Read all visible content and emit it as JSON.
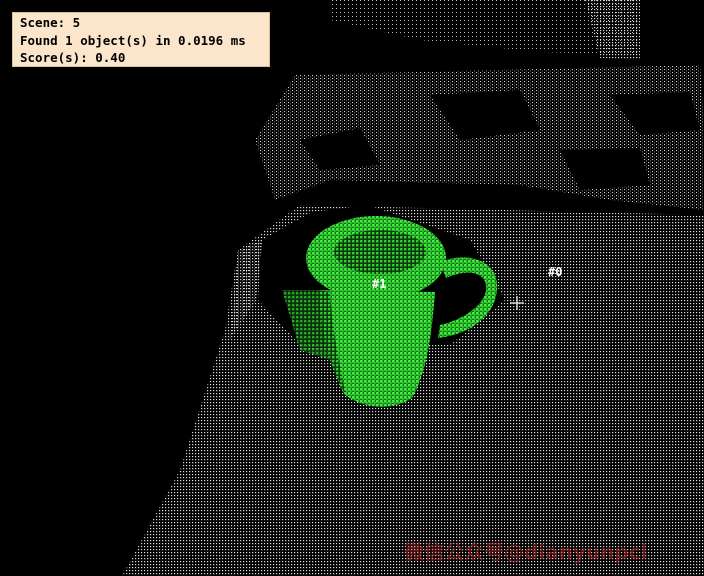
{
  "window": {
    "background": "#000000"
  },
  "info_panel": {
    "scene_line": "Scene: 5",
    "found_line": "Found 1 object(s) in 0.0196 ms",
    "score_line": "Score(s): 0.40",
    "background": "#fbe6cb"
  },
  "point_cloud": {
    "scene_points_color": "#e6e6e6",
    "detected_model_color": "#33ff33",
    "detected_object": "mug"
  },
  "labels": {
    "object_1": "#1",
    "object_0": "#0"
  },
  "cursor": {
    "icon": "crosshair-cursor-icon"
  },
  "watermark": {
    "text": "微信公众号@dianyunpcl"
  }
}
